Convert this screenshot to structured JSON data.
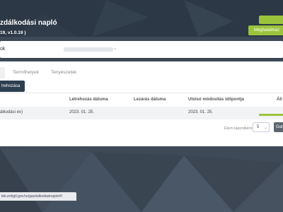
{
  "header": {
    "title": "zdálkodási napló",
    "version": "19, v1.0.19 )",
    "action_button": "Meghatalmaz"
  },
  "selector": {
    "label": "ok",
    "chevron": "chevron-down-icon"
  },
  "tabs": [
    {
      "label": ""
    },
    {
      "label": "Termőhelyek"
    },
    {
      "label": "Tenyészetek"
    }
  ],
  "create_button": "trehozása",
  "table": {
    "columns": [
      "Létrehozás dátuma",
      "Lezárás dátuma",
      "Utolsó módosítás időpontja",
      "Áll"
    ],
    "rows": [
      {
        "name": "álkodási év)",
        "created": "2023. 01. 25.",
        "closed": "",
        "modified": "2023. 01. 25."
      }
    ]
  },
  "pager": {
    "label": "Elem lapontként:",
    "value": "5",
    "button": "Gar"
  },
  "status_url": "tek.enhgtl.gov.hu/gazdalkodasinaplo/#/",
  "colors": {
    "accent_green": "#9bc43c",
    "header_dark": "#2e3a47",
    "button_dark": "#2d3e50"
  }
}
